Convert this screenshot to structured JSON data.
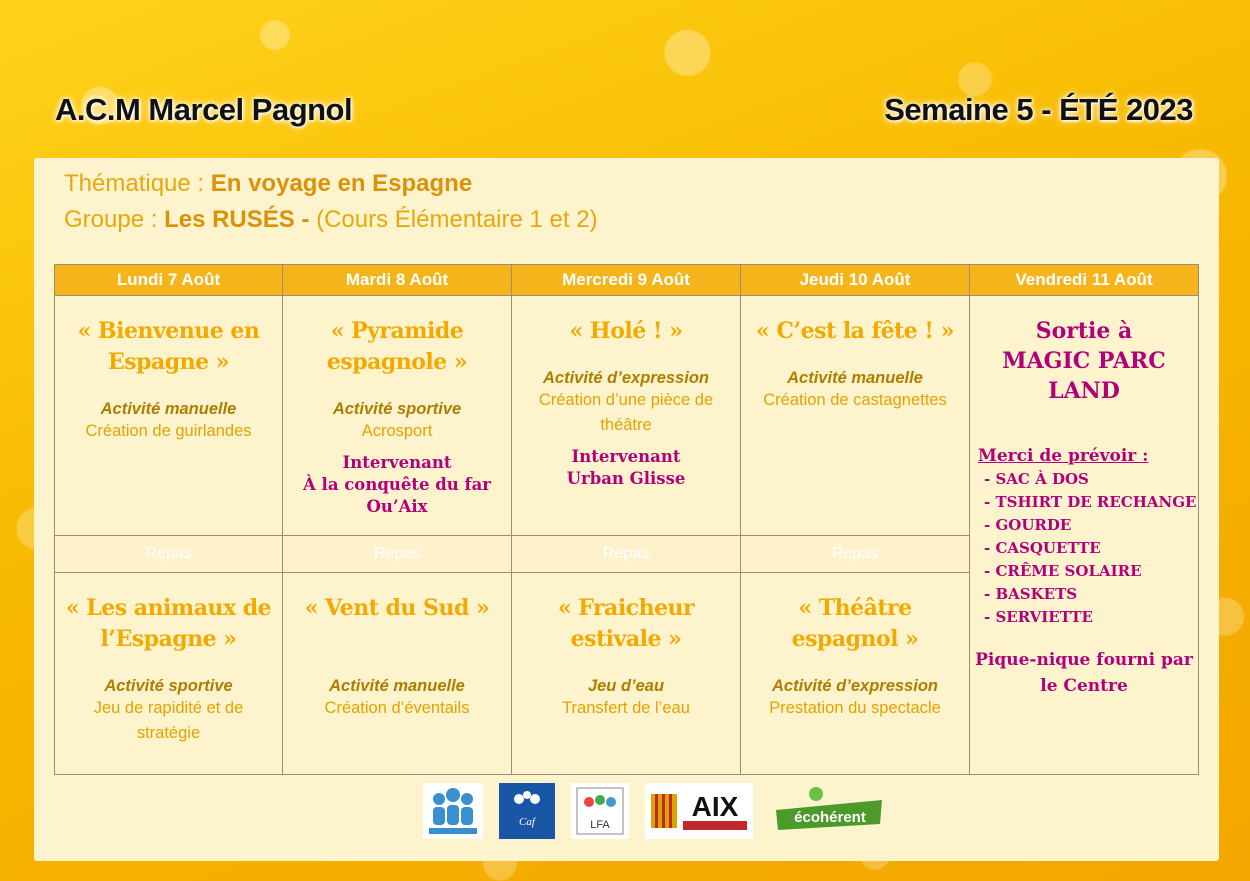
{
  "header": {
    "center_name": "A.C.M Marcel Pagnol",
    "week": "Semaine 5 - ÉTÉ 2023"
  },
  "meta": {
    "theme_label": "Thématique : ",
    "theme_value": "En voyage en Espagne",
    "group_label": "Groupe : ",
    "group_value": "Les RUSÉS - ",
    "group_detail": "(Cours Élémentaire 1 et 2)"
  },
  "days": [
    "Lundi 7 Août",
    "Mardi 8 Août",
    "Mercredi 9 Août",
    "Jeudi 10 Août",
    "Vendredi 11 Août"
  ],
  "morning": [
    {
      "title": "« Bienvenue en Espagne »",
      "type": "Activité manuelle",
      "desc": "Création de guirlandes",
      "interv_label": "",
      "interv_name": ""
    },
    {
      "title": "« Pyramide espagnole »",
      "type": "Activité sportive",
      "desc": "Acrosport",
      "interv_label": "Intervenant",
      "interv_name": "À la conquête du far Ou’Aix"
    },
    {
      "title": "« Holé ! »",
      "type": "Activité d’expression",
      "desc": "Création d’une pièce de théâtre",
      "interv_label": "Intervenant",
      "interv_name": "Urban Glisse"
    },
    {
      "title": "« C’est la fête ! »",
      "type": "Activité manuelle",
      "desc": "Création de castagnettes",
      "interv_label": "",
      "interv_name": ""
    }
  ],
  "lunch_label": "Repas",
  "afternoon": [
    {
      "title": "« Les animaux de l’Espagne »",
      "type": "Activité sportive",
      "desc": "Jeu de rapidité et de stratégie"
    },
    {
      "title": "« Vent du Sud »",
      "type": "Activité manuelle",
      "desc": "Création d’éventails"
    },
    {
      "title": "« Fraicheur estivale »",
      "type": "Jeu d’eau",
      "desc": "Transfert de l’eau"
    },
    {
      "title": "« Théâtre espagnol »",
      "type": "Activité d’expression",
      "desc": "Prestation du spectacle"
    }
  ],
  "friday": {
    "title_line1": "Sortie à",
    "title_line2": "MAGIC PARC LAND",
    "merci": "Merci de prévoir :",
    "items": [
      "- SAC À DOS",
      "- TSHIRT DE RECHANGE",
      "- GOURDE",
      "- CASQUETTE",
      "- CRÊME SOLAIRE",
      "- BASKETS",
      "- SERVIETTE"
    ],
    "footer": "Pique-nique fourni par le Centre"
  },
  "logos": [
    "Jean Paul Coste",
    "Caf des Bouches-du-Rhône",
    "LFA",
    "AIX EN PROVENCE LA VILLE",
    "Centre écohérent"
  ],
  "colors": {
    "header_bg": "#f6b41c",
    "title_orange": "#f2a900",
    "magenta": "#b1007a",
    "panel": "#fdf3cd"
  }
}
